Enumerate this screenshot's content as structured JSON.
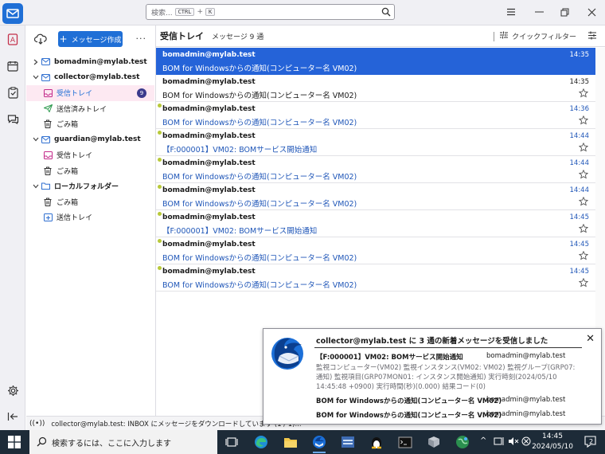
{
  "search": {
    "placeholder": "検索...",
    "key1": "CTRL",
    "plus": "+",
    "key2": "K"
  },
  "folder_pane": {
    "compose_label": "メッセージ作成",
    "folders": [
      {
        "label": "bomadmin@mylab.test",
        "type": "account",
        "twisty": "collapsed",
        "icon": "mail-account-icon"
      },
      {
        "label": "collector@mylab.test",
        "type": "account",
        "twisty": "expanded",
        "icon": "mail-account-icon"
      },
      {
        "label": "受信トレイ",
        "type": "folder",
        "icon": "inbox-icon",
        "selected": true,
        "badge": "9"
      },
      {
        "label": "送信済みトレイ",
        "type": "folder",
        "icon": "sent-icon"
      },
      {
        "label": "ごみ箱",
        "type": "folder",
        "icon": "trash-icon"
      },
      {
        "label": "guardian@mylab.test",
        "type": "account",
        "twisty": "expanded",
        "icon": "mail-account-icon"
      },
      {
        "label": "受信トレイ",
        "type": "folder",
        "icon": "inbox-icon"
      },
      {
        "label": "ごみ箱",
        "type": "folder",
        "icon": "trash-icon"
      },
      {
        "label": "ローカルフォルダー",
        "type": "local",
        "twisty": "expanded",
        "icon": "local-folder-icon"
      },
      {
        "label": "ごみ箱",
        "type": "folder",
        "icon": "trash-icon"
      },
      {
        "label": "送信トレイ",
        "type": "folder",
        "icon": "outbox-icon"
      }
    ]
  },
  "thread_pane": {
    "title": "受信トレイ",
    "count": "メッセージ 9 通",
    "quick_filter_label": "クイックフィルター",
    "messages": [
      {
        "from": "bomadmin@mylab.test",
        "subject": "BOM for Windowsからの通知(コンピューター名 VM02)",
        "time": "14:35",
        "selected": true,
        "unread": false
      },
      {
        "from": "bomadmin@mylab.test",
        "subject": "BOM for Windowsからの通知(コンピューター名 VM02)",
        "time": "14:35",
        "selected": false,
        "unread": false
      },
      {
        "from": "bomadmin@mylab.test",
        "subject": "BOM for Windowsからの通知(コンピューター名 VM02)",
        "time": "14:36",
        "selected": false,
        "unread": true
      },
      {
        "from": "bomadmin@mylab.test",
        "subject": "【F:000001】VM02: BOMサービス開始通知",
        "time": "14:44",
        "selected": false,
        "unread": true
      },
      {
        "from": "bomadmin@mylab.test",
        "subject": "BOM for Windowsからの通知(コンピューター名 VM02)",
        "time": "14:44",
        "selected": false,
        "unread": true
      },
      {
        "from": "bomadmin@mylab.test",
        "subject": "BOM for Windowsからの通知(コンピューター名 VM02)",
        "time": "14:44",
        "selected": false,
        "unread": true
      },
      {
        "from": "bomadmin@mylab.test",
        "subject": "【F:000001】VM02: BOMサービス開始通知",
        "time": "14:45",
        "selected": false,
        "unread": true
      },
      {
        "from": "bomadmin@mylab.test",
        "subject": "BOM for Windowsからの通知(コンピューター名 VM02)",
        "time": "14:45",
        "selected": false,
        "unread": true
      },
      {
        "from": "bomadmin@mylab.test",
        "subject": "BOM for Windowsからの通知(コンピューター名 VM02)",
        "time": "14:45",
        "selected": false,
        "unread": true
      }
    ]
  },
  "status_bar": {
    "text": "collector@mylab.test: INBOX にメッセージをダウンロードしています (1 / 1)..."
  },
  "notification": {
    "title": "collector@mylab.test に 3 通の新着メッセージを受信しました",
    "items": [
      {
        "subject": "【F:000001】VM02: BOMサービス開始通知",
        "from": "bomadmin@mylab.test"
      },
      {
        "subject": "BOM for Windowsからの通知(コンピューター名 VM02)",
        "from": "bomadmin@mylab.test"
      },
      {
        "subject": "BOM for Windowsからの通知(コンピューター名 VM02)",
        "from": "bomadmin@mylab.test"
      }
    ],
    "preview": "監視コンピューター(VM02) 監視インスタンス(VM02: VM02) 監視グループ(GRP07: 通知) 監視項目(GRP07MON01: インスタンス開始通知) 実行時刻(2024/05/10 14:45:48 +0900) 実行時間(秒)(0.000) 結果コード(0)"
  },
  "taskbar": {
    "search_placeholder": "検索するには、ここに入力します",
    "time": "14:45",
    "date": "2024/05/10",
    "notification_count": "2"
  },
  "colors": {
    "accent": "#1f6fd6",
    "selected_row": "#2563d8",
    "unread_subject": "#1f56b8",
    "taskbar": "#1d2b38"
  }
}
